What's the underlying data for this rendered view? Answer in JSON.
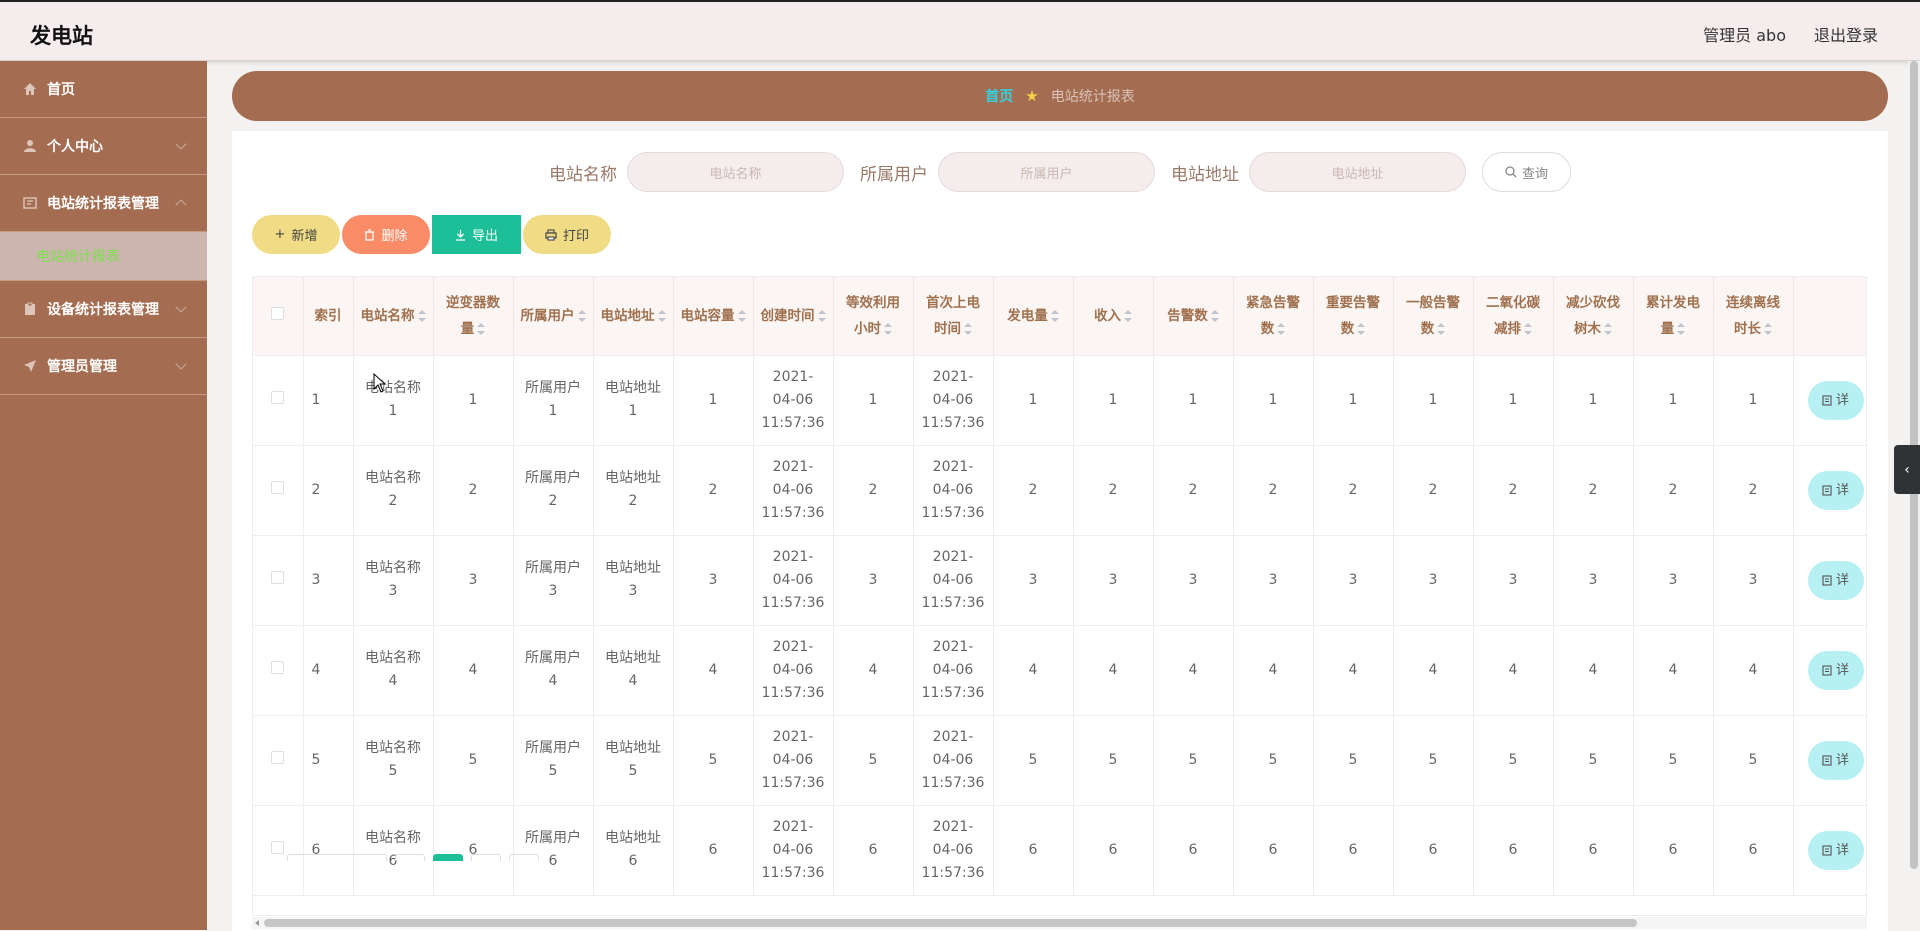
{
  "app": {
    "title": "发电站",
    "admin": "管理员 abo",
    "logout": "退出登录"
  },
  "sidebar": {
    "items": [
      {
        "label": "首页",
        "icon": "home-icon"
      },
      {
        "label": "个人中心",
        "icon": "user-icon"
      },
      {
        "label": "电站统计报表管理",
        "icon": "report-icon"
      },
      {
        "label": "设备统计报表管理",
        "icon": "clipboard-icon"
      },
      {
        "label": "管理员管理",
        "icon": "send-icon"
      }
    ],
    "submenu": "电站统计报表"
  },
  "breadcrumb": {
    "home": "首页",
    "star": "★",
    "current": "电站统计报表"
  },
  "search": {
    "name_label": "电站名称",
    "name_placeholder": "电站名称",
    "user_label": "所属用户",
    "user_placeholder": "所属用户",
    "addr_label": "电站地址",
    "addr_placeholder": "电站地址",
    "query": "查询"
  },
  "actions": {
    "add": "新增",
    "delete": "删除",
    "export": "导出",
    "print": "打印"
  },
  "table": {
    "headers": [
      "索引",
      "电站名称",
      "逆变器数量",
      "所属用户",
      "电站地址",
      "电站容量",
      "创建时间",
      "等效利用小时",
      "首次上电时间",
      "发电量",
      "收入",
      "告警数",
      "紧急告警数",
      "重要告警数",
      "一般告警数",
      "二氧化碳减排",
      "减少砍伐树木",
      "累计发电量",
      "连续离线时长"
    ],
    "rows": [
      [
        "1",
        "电站名称1",
        "1",
        "所属用户1",
        "电站地址1",
        "1",
        "2021-04-06 11:57:36",
        "1",
        "2021-04-06 11:57:36",
        "1",
        "1",
        "1",
        "1",
        "1",
        "1",
        "1",
        "1",
        "1",
        "1"
      ],
      [
        "2",
        "电站名称2",
        "2",
        "所属用户2",
        "电站地址2",
        "2",
        "2021-04-06 11:57:36",
        "2",
        "2021-04-06 11:57:36",
        "2",
        "2",
        "2",
        "2",
        "2",
        "2",
        "2",
        "2",
        "2",
        "2"
      ],
      [
        "3",
        "电站名称3",
        "3",
        "所属用户3",
        "电站地址3",
        "3",
        "2021-04-06 11:57:36",
        "3",
        "2021-04-06 11:57:36",
        "3",
        "3",
        "3",
        "3",
        "3",
        "3",
        "3",
        "3",
        "3",
        "3"
      ],
      [
        "4",
        "电站名称4",
        "4",
        "所属用户4",
        "电站地址4",
        "4",
        "2021-04-06 11:57:36",
        "4",
        "2021-04-06 11:57:36",
        "4",
        "4",
        "4",
        "4",
        "4",
        "4",
        "4",
        "4",
        "4",
        "4"
      ],
      [
        "5",
        "电站名称5",
        "5",
        "所属用户5",
        "电站地址5",
        "5",
        "2021-04-06 11:57:36",
        "5",
        "2021-04-06 11:57:36",
        "5",
        "5",
        "5",
        "5",
        "5",
        "5",
        "5",
        "5",
        "5",
        "5"
      ],
      [
        "6",
        "电站名称6",
        "6",
        "所属用户6",
        "电站地址6",
        "6",
        "2021-04-06 11:57:36",
        "6",
        "2021-04-06 11:57:36",
        "6",
        "6",
        "6",
        "6",
        "6",
        "6",
        "6",
        "6",
        "6",
        "6"
      ]
    ],
    "row_action": "详"
  },
  "colors": {
    "brand": "#a46c50",
    "accent": "#1cbf98",
    "danger": "#f98b66",
    "warn": "#f0dc85",
    "info": "#b6f0f3"
  }
}
